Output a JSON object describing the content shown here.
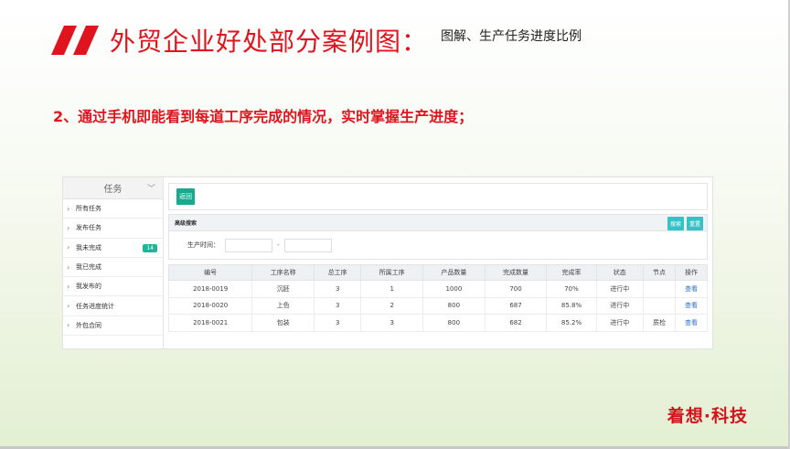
{
  "slide": {
    "title": "外贸企业好处部分案例图：",
    "subtitle": "图解、生产任务进度比例",
    "point": "2、通过手机即能看到每道工序完成的情况，实时掌握生产进度；",
    "brand": "着想·科技",
    "accent_color": "#e0141e"
  },
  "app": {
    "sidebar": {
      "header": "任务",
      "items": [
        {
          "label": "所有任务",
          "badge": ""
        },
        {
          "label": "发布任务",
          "badge": ""
        },
        {
          "label": "我未完成",
          "badge": "14"
        },
        {
          "label": "我已完成",
          "badge": ""
        },
        {
          "label": "我发布的",
          "badge": ""
        },
        {
          "label": "任务进度统计",
          "badge": ""
        },
        {
          "label": "外包合同",
          "badge": ""
        }
      ]
    },
    "back_button": "返回",
    "search": {
      "title": "高级搜索",
      "search_button": "搜索",
      "reset_button": "重置",
      "time_label": "生产时间：",
      "separator": "-"
    },
    "table": {
      "headers": [
        "编号",
        "工序名称",
        "总工序",
        "所属工序",
        "产品数量",
        "完成数量",
        "完成率",
        "状态",
        "节点",
        "操作"
      ],
      "rows": [
        [
          "2018-0019",
          "沉胚",
          "3",
          "1",
          "1000",
          "700",
          "70%",
          "进行中",
          "",
          "查看"
        ],
        [
          "2018-0020",
          "上色",
          "3",
          "2",
          "800",
          "687",
          "85.8%",
          "进行中",
          "",
          "查看"
        ],
        [
          "2018-0021",
          "包装",
          "3",
          "3",
          "800",
          "682",
          "85.2%",
          "进行中",
          "质检",
          "查看"
        ]
      ]
    }
  }
}
